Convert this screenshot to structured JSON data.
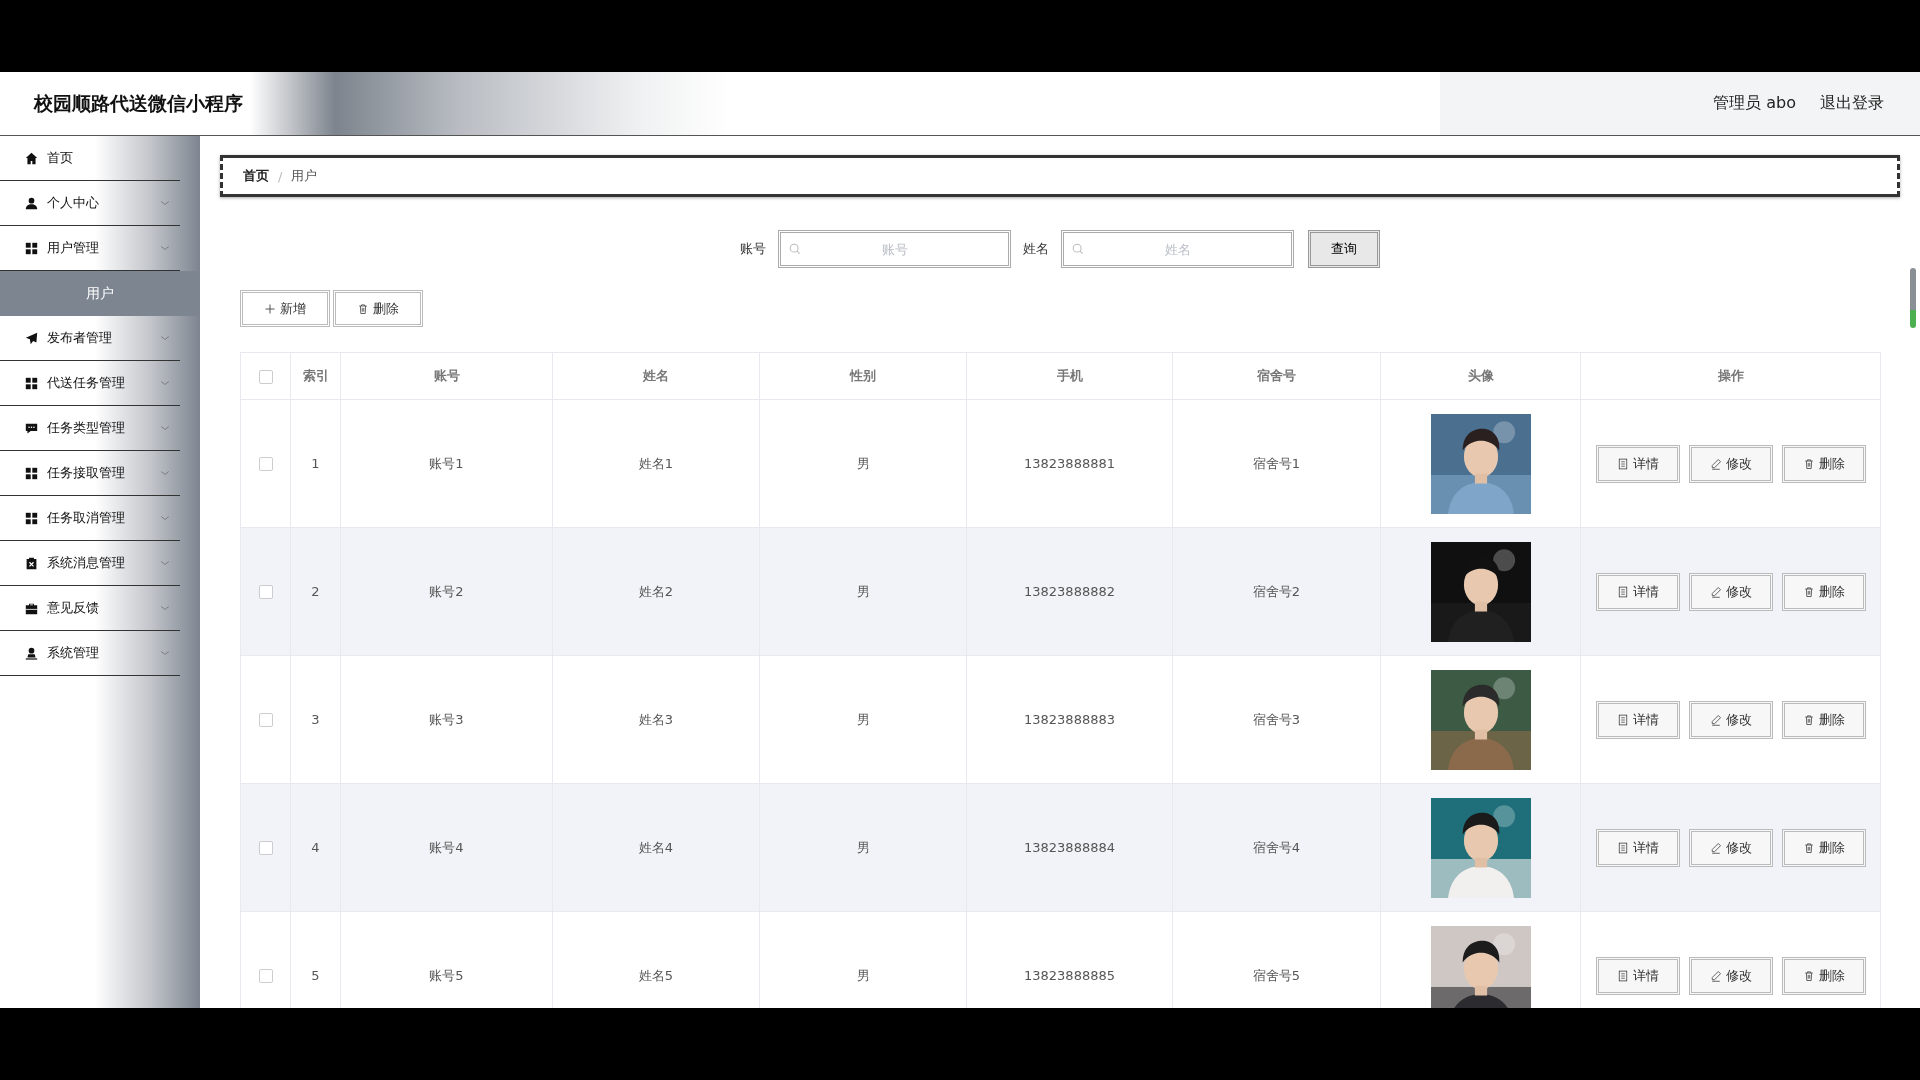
{
  "header": {
    "title": "校园顺路代送微信小程序",
    "user": "管理员 abo",
    "logout": "退出登录"
  },
  "sidebar": {
    "items": [
      {
        "label": "首页",
        "kind": "link"
      },
      {
        "label": "个人中心",
        "kind": "group"
      },
      {
        "label": "用户管理",
        "kind": "group",
        "children": [
          {
            "label": "用户",
            "selected": true
          }
        ]
      },
      {
        "label": "发布者管理",
        "kind": "group"
      },
      {
        "label": "代送任务管理",
        "kind": "group"
      },
      {
        "label": "任务类型管理",
        "kind": "group"
      },
      {
        "label": "任务接取管理",
        "kind": "group"
      },
      {
        "label": "任务取消管理",
        "kind": "group"
      },
      {
        "label": "系统消息管理",
        "kind": "group"
      },
      {
        "label": "意见反馈",
        "kind": "group"
      },
      {
        "label": "系统管理",
        "kind": "group"
      }
    ]
  },
  "breadcrumb": {
    "items": [
      "首页",
      "用户"
    ],
    "separator": "/"
  },
  "search": {
    "fields": [
      {
        "label": "账号",
        "placeholder": "账号"
      },
      {
        "label": "姓名",
        "placeholder": "姓名"
      }
    ],
    "button": "查询"
  },
  "toolbar": [
    {
      "kind": "add",
      "label": "新增"
    },
    {
      "kind": "delete",
      "label": "删除"
    }
  ],
  "table": {
    "select_all": false,
    "columns": [
      "索引",
      "账号",
      "姓名",
      "性别",
      "手机",
      "宿舍号",
      "头像",
      "操作"
    ],
    "rows": [
      {
        "checked": false,
        "cells": [
          "1",
          "账号1",
          "姓名1",
          "男",
          "13823888881",
          "宿舍号1"
        ],
        "actions": [
          {
            "kind": "detail",
            "label": "详情"
          },
          {
            "kind": "edit",
            "label": "修改"
          },
          {
            "kind": "delete",
            "label": "删除"
          }
        ]
      },
      {
        "checked": false,
        "cells": [
          "2",
          "账号2",
          "姓名2",
          "男",
          "13823888882",
          "宿舍号2"
        ],
        "actions": [
          {
            "kind": "detail",
            "label": "详情"
          },
          {
            "kind": "edit",
            "label": "修改"
          },
          {
            "kind": "delete",
            "label": "删除"
          }
        ]
      },
      {
        "checked": false,
        "cells": [
          "3",
          "账号3",
          "姓名3",
          "男",
          "13823888883",
          "宿舍号3"
        ],
        "actions": [
          {
            "kind": "detail",
            "label": "详情"
          },
          {
            "kind": "edit",
            "label": "修改"
          },
          {
            "kind": "delete",
            "label": "删除"
          }
        ]
      },
      {
        "checked": false,
        "cells": [
          "4",
          "账号4",
          "姓名4",
          "男",
          "13823888884",
          "宿舍号4"
        ],
        "actions": [
          {
            "kind": "detail",
            "label": "详情"
          },
          {
            "kind": "edit",
            "label": "修改"
          },
          {
            "kind": "delete",
            "label": "删除"
          }
        ]
      },
      {
        "checked": false,
        "cells": [
          "5",
          "账号5",
          "姓名5",
          "男",
          "13823888885",
          "宿舍号5"
        ],
        "actions": [
          {
            "kind": "detail",
            "label": "详情"
          },
          {
            "kind": "edit",
            "label": "修改"
          },
          {
            "kind": "delete",
            "label": "删除"
          }
        ]
      }
    ]
  }
}
